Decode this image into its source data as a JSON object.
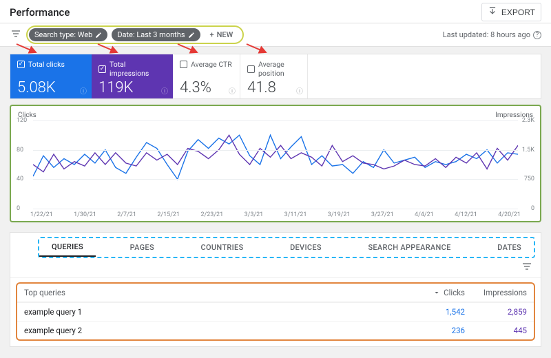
{
  "header": {
    "title": "Performance",
    "export_label": "EXPORT"
  },
  "filters": {
    "chip1": "Search type: Web",
    "chip2": "Date: Last 3 months",
    "new_label": "NEW",
    "last_updated": "Last updated: 8 hours ago"
  },
  "metrics": {
    "clicks": {
      "label": "Total clicks",
      "value": "5.08K"
    },
    "impressions": {
      "label": "Total impressions",
      "value": "119K"
    },
    "ctr": {
      "label": "Average CTR",
      "value": "4.3%"
    },
    "position": {
      "label": "Average position",
      "value": "41.8"
    }
  },
  "chart_data": {
    "type": "line",
    "title": "",
    "left_axis_label": "Clicks",
    "right_axis_label": "Impressions",
    "left_ticks": [
      "120",
      "80",
      "40",
      "0"
    ],
    "right_ticks": [
      "2.3K",
      "1.5K",
      "750",
      "0"
    ],
    "x_labels": [
      "1/22/21",
      "1/30/21",
      "2/7/21",
      "2/15/21",
      "2/23/21",
      "3/3/21",
      "3/11/21",
      "3/19/21",
      "3/27/21",
      "4/4/21",
      "4/12/21",
      "4/20/21"
    ],
    "series": [
      {
        "name": "Clicks",
        "color": "#1a73e8",
        "values": [
          44,
          72,
          56,
          68,
          60,
          74,
          62,
          80,
          56,
          48,
          70,
          90,
          82,
          60,
          40,
          78,
          94,
          82,
          96,
          88,
          100,
          72,
          60,
          100,
          68,
          84,
          98,
          60,
          72,
          58,
          60,
          48,
          64,
          56,
          80,
          62,
          66,
          70,
          56,
          64,
          60,
          64,
          74,
          68,
          80,
          62,
          76,
          74
        ]
      },
      {
        "name": "Impressions",
        "color": "#5e35b1",
        "values": [
          60,
          50,
          74,
          54,
          64,
          58,
          76,
          60,
          76,
          62,
          58,
          76,
          66,
          74,
          60,
          82,
          78,
          68,
          80,
          100,
          74,
          60,
          82,
          70,
          86,
          68,
          76,
          70,
          58,
          86,
          64,
          72,
          62,
          60,
          54,
          58,
          66,
          60,
          58,
          68,
          56,
          70,
          62,
          76,
          54,
          82,
          66,
          86
        ]
      }
    ]
  },
  "tabs": {
    "items": [
      "QUERIES",
      "PAGES",
      "COUNTRIES",
      "DEVICES",
      "SEARCH APPEARANCE",
      "DATES"
    ],
    "active_index": 0
  },
  "table": {
    "col1": "Top queries",
    "col2": "Clicks",
    "col3": "Impressions",
    "rows": [
      {
        "query": "example query 1",
        "clicks": "1,542",
        "impressions": "2,859"
      },
      {
        "query": "example query 2",
        "clicks": "236",
        "impressions": "445"
      }
    ]
  }
}
